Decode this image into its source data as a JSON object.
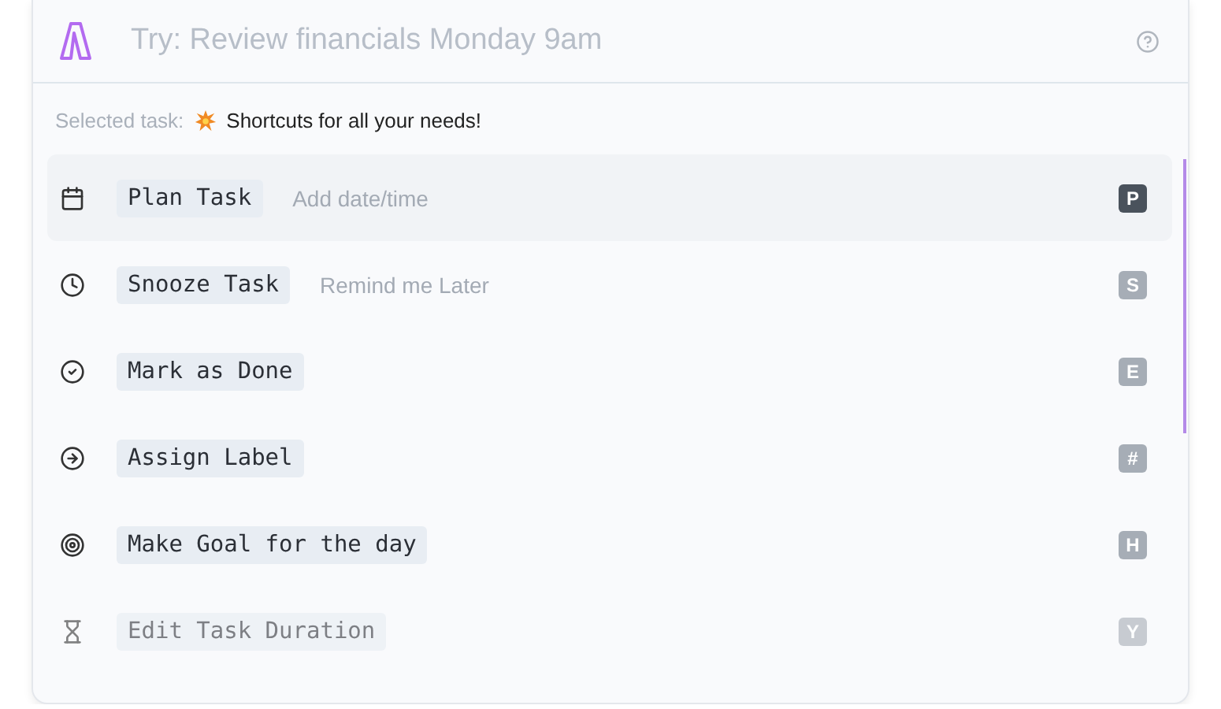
{
  "search": {
    "placeholder": "Try: Review financials Monday 9am"
  },
  "selected_task": {
    "label": "Selected task:",
    "value": "Shortcuts for all your needs!"
  },
  "commands": [
    {
      "label": "Plan Task",
      "hint": "Add date/time",
      "key": "P",
      "selected": true,
      "dimmed": false
    },
    {
      "label": "Snooze Task",
      "hint": "Remind me Later",
      "key": "S",
      "selected": false,
      "dimmed": false
    },
    {
      "label": "Mark as Done",
      "key": "E",
      "selected": false,
      "dimmed": false
    },
    {
      "label": "Assign Label",
      "key": "#",
      "selected": false,
      "dimmed": false
    },
    {
      "label": "Make Goal for the day",
      "key": "H",
      "selected": false,
      "dimmed": false
    },
    {
      "label": "Edit Task Duration",
      "key": "Y",
      "selected": false,
      "dimmed": true
    }
  ]
}
